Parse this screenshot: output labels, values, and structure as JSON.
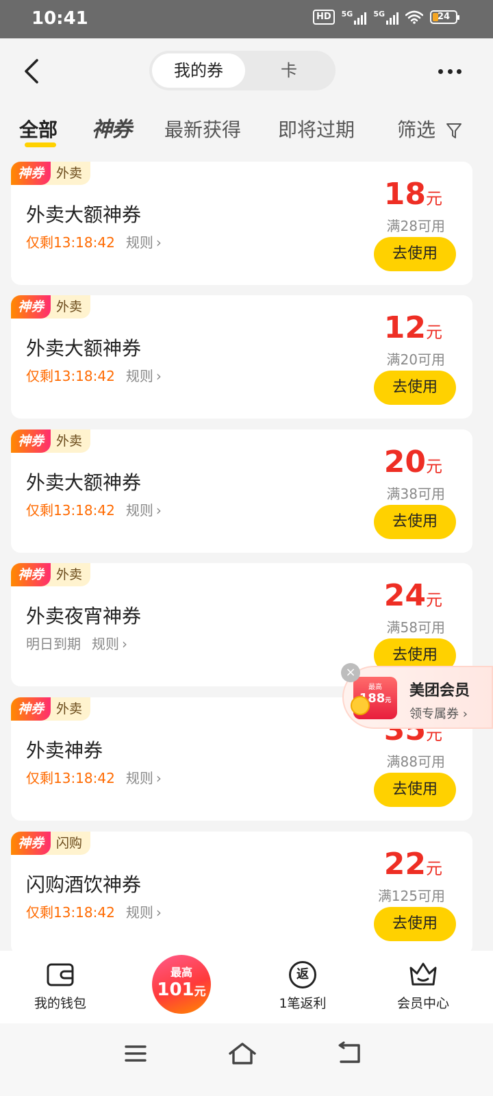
{
  "status_bar": {
    "time": "10:41",
    "hd_label": "HD",
    "network_1": "5G",
    "network_2": "5G",
    "battery": "24"
  },
  "header": {
    "segments": [
      "我的券",
      "卡"
    ]
  },
  "tabs": [
    "全部",
    "神券",
    "最新获得",
    "即将过期",
    "筛选"
  ],
  "coupons": [
    {
      "badge": "神券",
      "category": "外卖",
      "title": "外卖大额神券",
      "expiry": "仅剩13:18:42",
      "rule": "规则",
      "amount": "18",
      "unit": "元",
      "threshold": "满28可用",
      "button": "去使用"
    },
    {
      "badge": "神券",
      "category": "外卖",
      "title": "外卖大额神券",
      "expiry": "仅剩13:18:42",
      "rule": "规则",
      "amount": "12",
      "unit": "元",
      "threshold": "满20可用",
      "button": "去使用"
    },
    {
      "badge": "神券",
      "category": "外卖",
      "title": "外卖大额神券",
      "expiry": "仅剩13:18:42",
      "rule": "规则",
      "amount": "20",
      "unit": "元",
      "threshold": "满38可用",
      "button": "去使用"
    },
    {
      "badge": "神券",
      "category": "外卖",
      "title": "外卖夜宵神券",
      "expiry": "明日到期",
      "rule": "规则",
      "amount": "24",
      "unit": "元",
      "threshold": "满58可用",
      "button": "去使用"
    },
    {
      "badge": "神券",
      "category": "外卖",
      "title": "外卖神券",
      "expiry": "仅剩13:18:42",
      "rule": "规则",
      "amount": "35",
      "unit": "元",
      "threshold": "满88可用",
      "button": "去使用"
    },
    {
      "badge": "神券",
      "category": "闪购",
      "title": "闪购酒饮神券",
      "expiry": "仅剩13:18:42",
      "rule": "规则",
      "amount": "22",
      "unit": "元",
      "threshold": "满125可用",
      "button": "去使用"
    }
  ],
  "member_popup": {
    "badge_top": "最高",
    "badge_value": "188",
    "badge_unit": "元",
    "title": "美团会员",
    "subtitle": "领专属券"
  },
  "bottom_bar": {
    "wallet": "我的钱包",
    "center_line1": "最高",
    "center_value": "101",
    "center_unit": "元",
    "rebate": "1笔返利",
    "rebate_icon_text": "返",
    "member_center": "会员中心"
  },
  "colors": {
    "accent_yellow": "#ffd100",
    "price_red": "#ee2e24",
    "expiry_orange": "#ff6a00"
  }
}
